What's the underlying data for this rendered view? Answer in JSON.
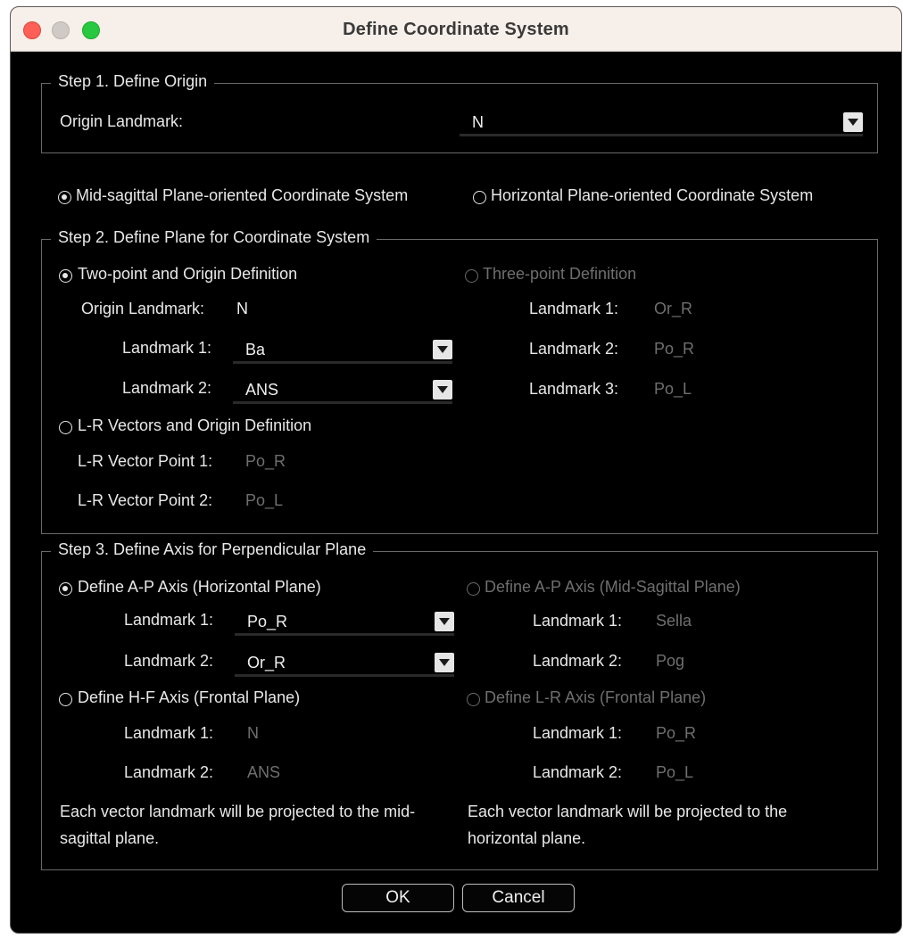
{
  "window": {
    "title": "Define Coordinate System"
  },
  "step1": {
    "legend": "Step 1. Define Origin",
    "origin_label": "Origin Landmark:",
    "origin_value": "N"
  },
  "modes": {
    "mid_sagittal": {
      "label": "Mid-sagittal Plane-oriented Coordinate System",
      "checked": true
    },
    "horizontal": {
      "label": "Horizontal Plane-oriented Coordinate System",
      "checked": false
    }
  },
  "step2": {
    "legend": "Step 2. Define Plane for Coordinate System",
    "two_point": {
      "label": "Two-point and Origin Definition",
      "origin_label": "Origin Landmark:",
      "origin_value": "N",
      "landmark1_label": "Landmark 1:",
      "landmark1_value": "Ba",
      "landmark2_label": "Landmark 2:",
      "landmark2_value": "ANS"
    },
    "three_point": {
      "label": "Three-point Definition",
      "landmark1_label": "Landmark 1:",
      "landmark1_value": "Or_R",
      "landmark2_label": "Landmark 2:",
      "landmark2_value": "Po_R",
      "landmark3_label": "Landmark 3:",
      "landmark3_value": "Po_L"
    },
    "lr_vectors": {
      "label": "L-R Vectors and Origin Definition",
      "point1_label": "L-R Vector Point 1:",
      "point1_value": "Po_R",
      "point2_label": "L-R Vector Point 2:",
      "point2_value": "Po_L"
    }
  },
  "step3": {
    "legend": "Step 3. Define Axis for Perpendicular Plane",
    "ap_horizontal": {
      "label": "Define A-P Axis (Horizontal Plane)",
      "landmark1_label": "Landmark 1:",
      "landmark1_value": "Po_R",
      "landmark2_label": "Landmark 2:",
      "landmark2_value": "Or_R"
    },
    "ap_midsagittal": {
      "label": "Define A-P Axis (Mid-Sagittal Plane)",
      "landmark1_label": "Landmark 1:",
      "landmark1_value": "Sella",
      "landmark2_label": "Landmark 2:",
      "landmark2_value": "Pog"
    },
    "hf_frontal": {
      "label": "Define H-F Axis (Frontal Plane)",
      "landmark1_label": "Landmark 1:",
      "landmark1_value": "N",
      "landmark2_label": "Landmark 2:",
      "landmark2_value": "ANS"
    },
    "lr_frontal": {
      "label": "Define L-R Axis (Frontal Plane)",
      "landmark1_label": "Landmark 1:",
      "landmark1_value": "Po_R",
      "landmark2_label": "Landmark 2:",
      "landmark2_value": "Po_L"
    },
    "note_left": "Each vector landmark will be projected to the mid-sagittal plane.",
    "note_right": "Each vector landmark will be projected to the horizontal plane."
  },
  "buttons": {
    "ok": "OK",
    "cancel": "Cancel"
  }
}
